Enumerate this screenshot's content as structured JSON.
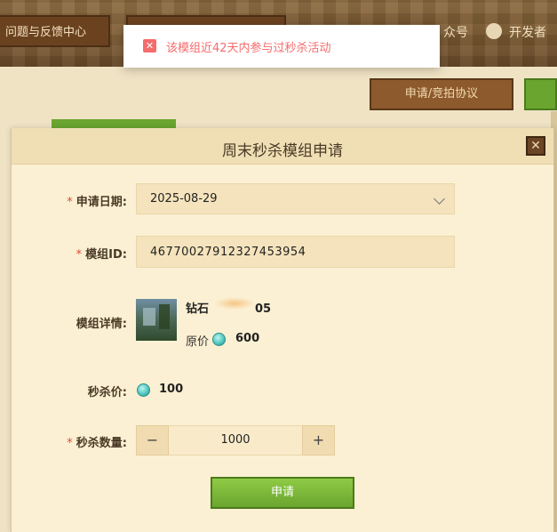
{
  "background": {
    "nav_feedback": "问题与反馈中心",
    "nav_public": "众号",
    "nav_developer": "开发者",
    "apply_button": "申请/竞拍协议"
  },
  "toast": {
    "icon": "error-icon",
    "message": "该模组近42天内参与过秒杀活动"
  },
  "modal": {
    "title": "周末秒杀模组申请",
    "close_label": "✕",
    "date": {
      "label": "申请日期:",
      "value": "2025-08-29"
    },
    "mod_id": {
      "label": "模组ID:",
      "value": "46770027912327453954"
    },
    "details": {
      "label": "模组详情:",
      "name": "钻石",
      "name_suffix": "05",
      "original_price_label": "原价",
      "original_price": "600"
    },
    "flash_price": {
      "label": "秒杀价:",
      "value": "100"
    },
    "quantity": {
      "label": "秒杀数量:",
      "minus": "−",
      "plus": "+",
      "value": "1000"
    },
    "submit_label": "申请"
  },
  "colors": {
    "error": "#f56c6c",
    "accent_green": "#6aa52f",
    "brown": "#6b4220"
  }
}
